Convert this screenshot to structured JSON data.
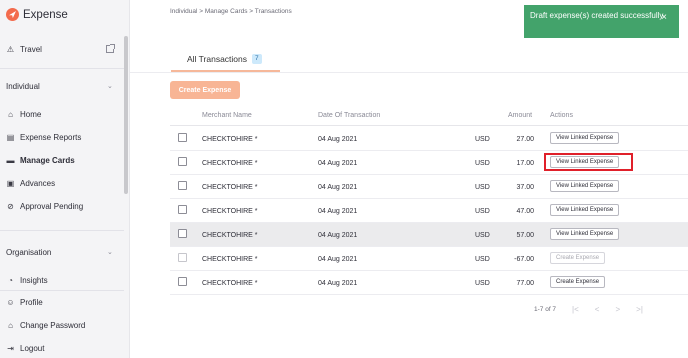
{
  "app": {
    "name": "Expense",
    "logo_icon": "paper-plane-logo-icon",
    "brand_color": "#f36b4d"
  },
  "sidebar": {
    "org_item": {
      "label": "Travel",
      "icon": "warning-triangle-icon"
    },
    "section_individual": "Individual",
    "items": [
      {
        "label": "Home",
        "icon": "home-icon"
      },
      {
        "label": "Expense Reports",
        "icon": "report-icon"
      },
      {
        "label": "Manage Cards",
        "icon": "card-icon",
        "active": true
      },
      {
        "label": "Advances",
        "icon": "advances-icon"
      },
      {
        "label": "Approval Pending",
        "icon": "check-circle-icon"
      }
    ],
    "section_organisation": "Organisation",
    "org_items": [
      {
        "label": "Insights",
        "icon": "pie-chart-icon"
      }
    ],
    "bottom_items": [
      {
        "label": "Profile",
        "icon": "user-icon"
      },
      {
        "label": "Change Password",
        "icon": "lock-icon"
      },
      {
        "label": "Logout",
        "icon": "logout-icon"
      }
    ]
  },
  "breadcrumb": "Individual  >  Manage Cards  >  Transactions",
  "tabs": [
    {
      "label": "All Transactions",
      "count": "7"
    }
  ],
  "create_button": "Create Expense",
  "table": {
    "headers": [
      "Merchant Name",
      "Date Of Transaction",
      "Amount",
      "Actions"
    ],
    "rows": [
      {
        "merchant": "CHECKTOHIRE *",
        "date": "04 Aug 2021",
        "currency": "USD",
        "amount": "27.00",
        "action": "View Linked Expense"
      },
      {
        "merchant": "CHECKTOHIRE *",
        "date": "04 Aug 2021",
        "currency": "USD",
        "amount": "17.00",
        "action": "View Linked Expense"
      },
      {
        "merchant": "CHECKTOHIRE *",
        "date": "04 Aug 2021",
        "currency": "USD",
        "amount": "37.00",
        "action": "View Linked Expense"
      },
      {
        "merchant": "CHECKTOHIRE *",
        "date": "04 Aug 2021",
        "currency": "USD",
        "amount": "47.00",
        "action": "View Linked Expense"
      },
      {
        "merchant": "CHECKTOHIRE *",
        "date": "04 Aug 2021",
        "currency": "USD",
        "amount": "57.00",
        "action": "View Linked Expense"
      },
      {
        "merchant": "CHECKTOHIRE *",
        "date": "04 Aug 2021",
        "currency": "USD",
        "amount": "-67.00",
        "action": "Create Expense"
      },
      {
        "merchant": "CHECKTOHIRE *",
        "date": "04 Aug 2021",
        "currency": "USD",
        "amount": "77.00",
        "action": "Create Expense"
      }
    ]
  },
  "pagination": {
    "range": "1-7 of 7",
    "first": "|<",
    "prev": "<",
    "next": ">",
    "last": ">|"
  },
  "toast": {
    "message": "Draft expense(s) created successfully",
    "close": "×",
    "color": "#43a36b"
  }
}
